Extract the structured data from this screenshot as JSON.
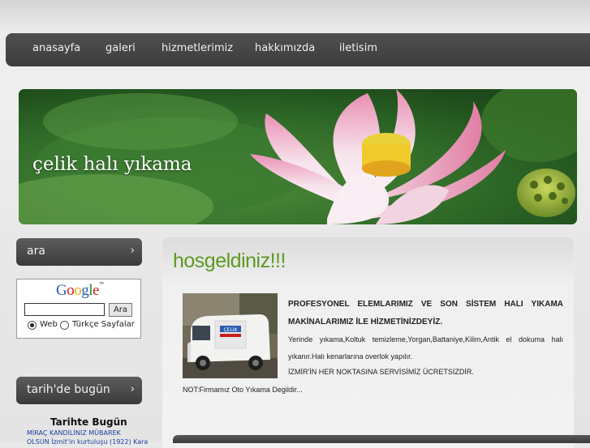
{
  "nav": {
    "items": [
      {
        "label": "anasayfa"
      },
      {
        "label": "galeri"
      },
      {
        "label": "hizmetlerimiz"
      },
      {
        "label": "hakkımızda"
      },
      {
        "label": "iletisim"
      }
    ]
  },
  "banner": {
    "title": "çelik halı yıkama"
  },
  "sidebar": {
    "search_heading": "ara",
    "chevron": "›",
    "google": {
      "logo": "Google",
      "search_button": "Ara",
      "option_web": "Web",
      "option_turkish": "Türkçe Sayfalar",
      "selected": "Web"
    },
    "history_heading": "tarih'de bugün",
    "history_box": {
      "title": "Tarihte Bugün",
      "line1": "MİRAÇ KANDİLİNİZ MÜBAREK",
      "line2": "OLSUN  İzmit'in kurtuluşu (1922) Kara"
    }
  },
  "main": {
    "title": "hosgeldiniz!!!",
    "van_text": "ÇELİK",
    "para_bold": "PROFESYONEL ELEMLARIMIZ VE SON SİSTEM HALI YIKAMA MAKİNALARIMIZ İLE HİZMETİNİZDEYİZ.",
    "para_services": "Yerinde yıkama,Koltuk temizleme,Yorgan,Battaniye,Kilim,Antik el dokuma halı yıkanır.Halı kenarlarına overlok yapılır.",
    "para_free": "İZMİR'İN HER NOKTASINA SERVİSİMİZ ÜCRETSİZDİR.",
    "note": "NOT:Firmamız Oto Yıkama Degildir..."
  },
  "colors": {
    "nav_bg": "#444444",
    "title_green": "#5c9a21",
    "link_blue": "#1a3fa0"
  }
}
